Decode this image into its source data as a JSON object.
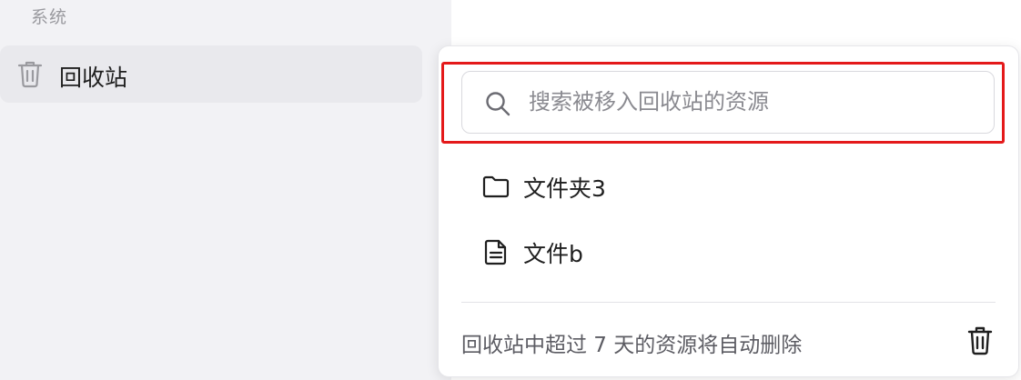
{
  "sidebar": {
    "section_label": "系统",
    "items": [
      {
        "label": "回收站",
        "icon": "trash-icon"
      }
    ]
  },
  "popover": {
    "search": {
      "placeholder": "搜索被移入回收站的资源",
      "value": "",
      "icon": "search-icon"
    },
    "items": [
      {
        "label": "文件夹3",
        "icon": "folder-icon"
      },
      {
        "label": "文件b",
        "icon": "document-icon"
      }
    ],
    "footer": {
      "text": "回收站中超过 7 天的资源将自动删除",
      "icon": "trash-icon"
    }
  },
  "colors": {
    "highlight": "#e4191a",
    "sidebar_bg": "#f2f2f5",
    "selected_item_bg": "#e9e9ed"
  }
}
